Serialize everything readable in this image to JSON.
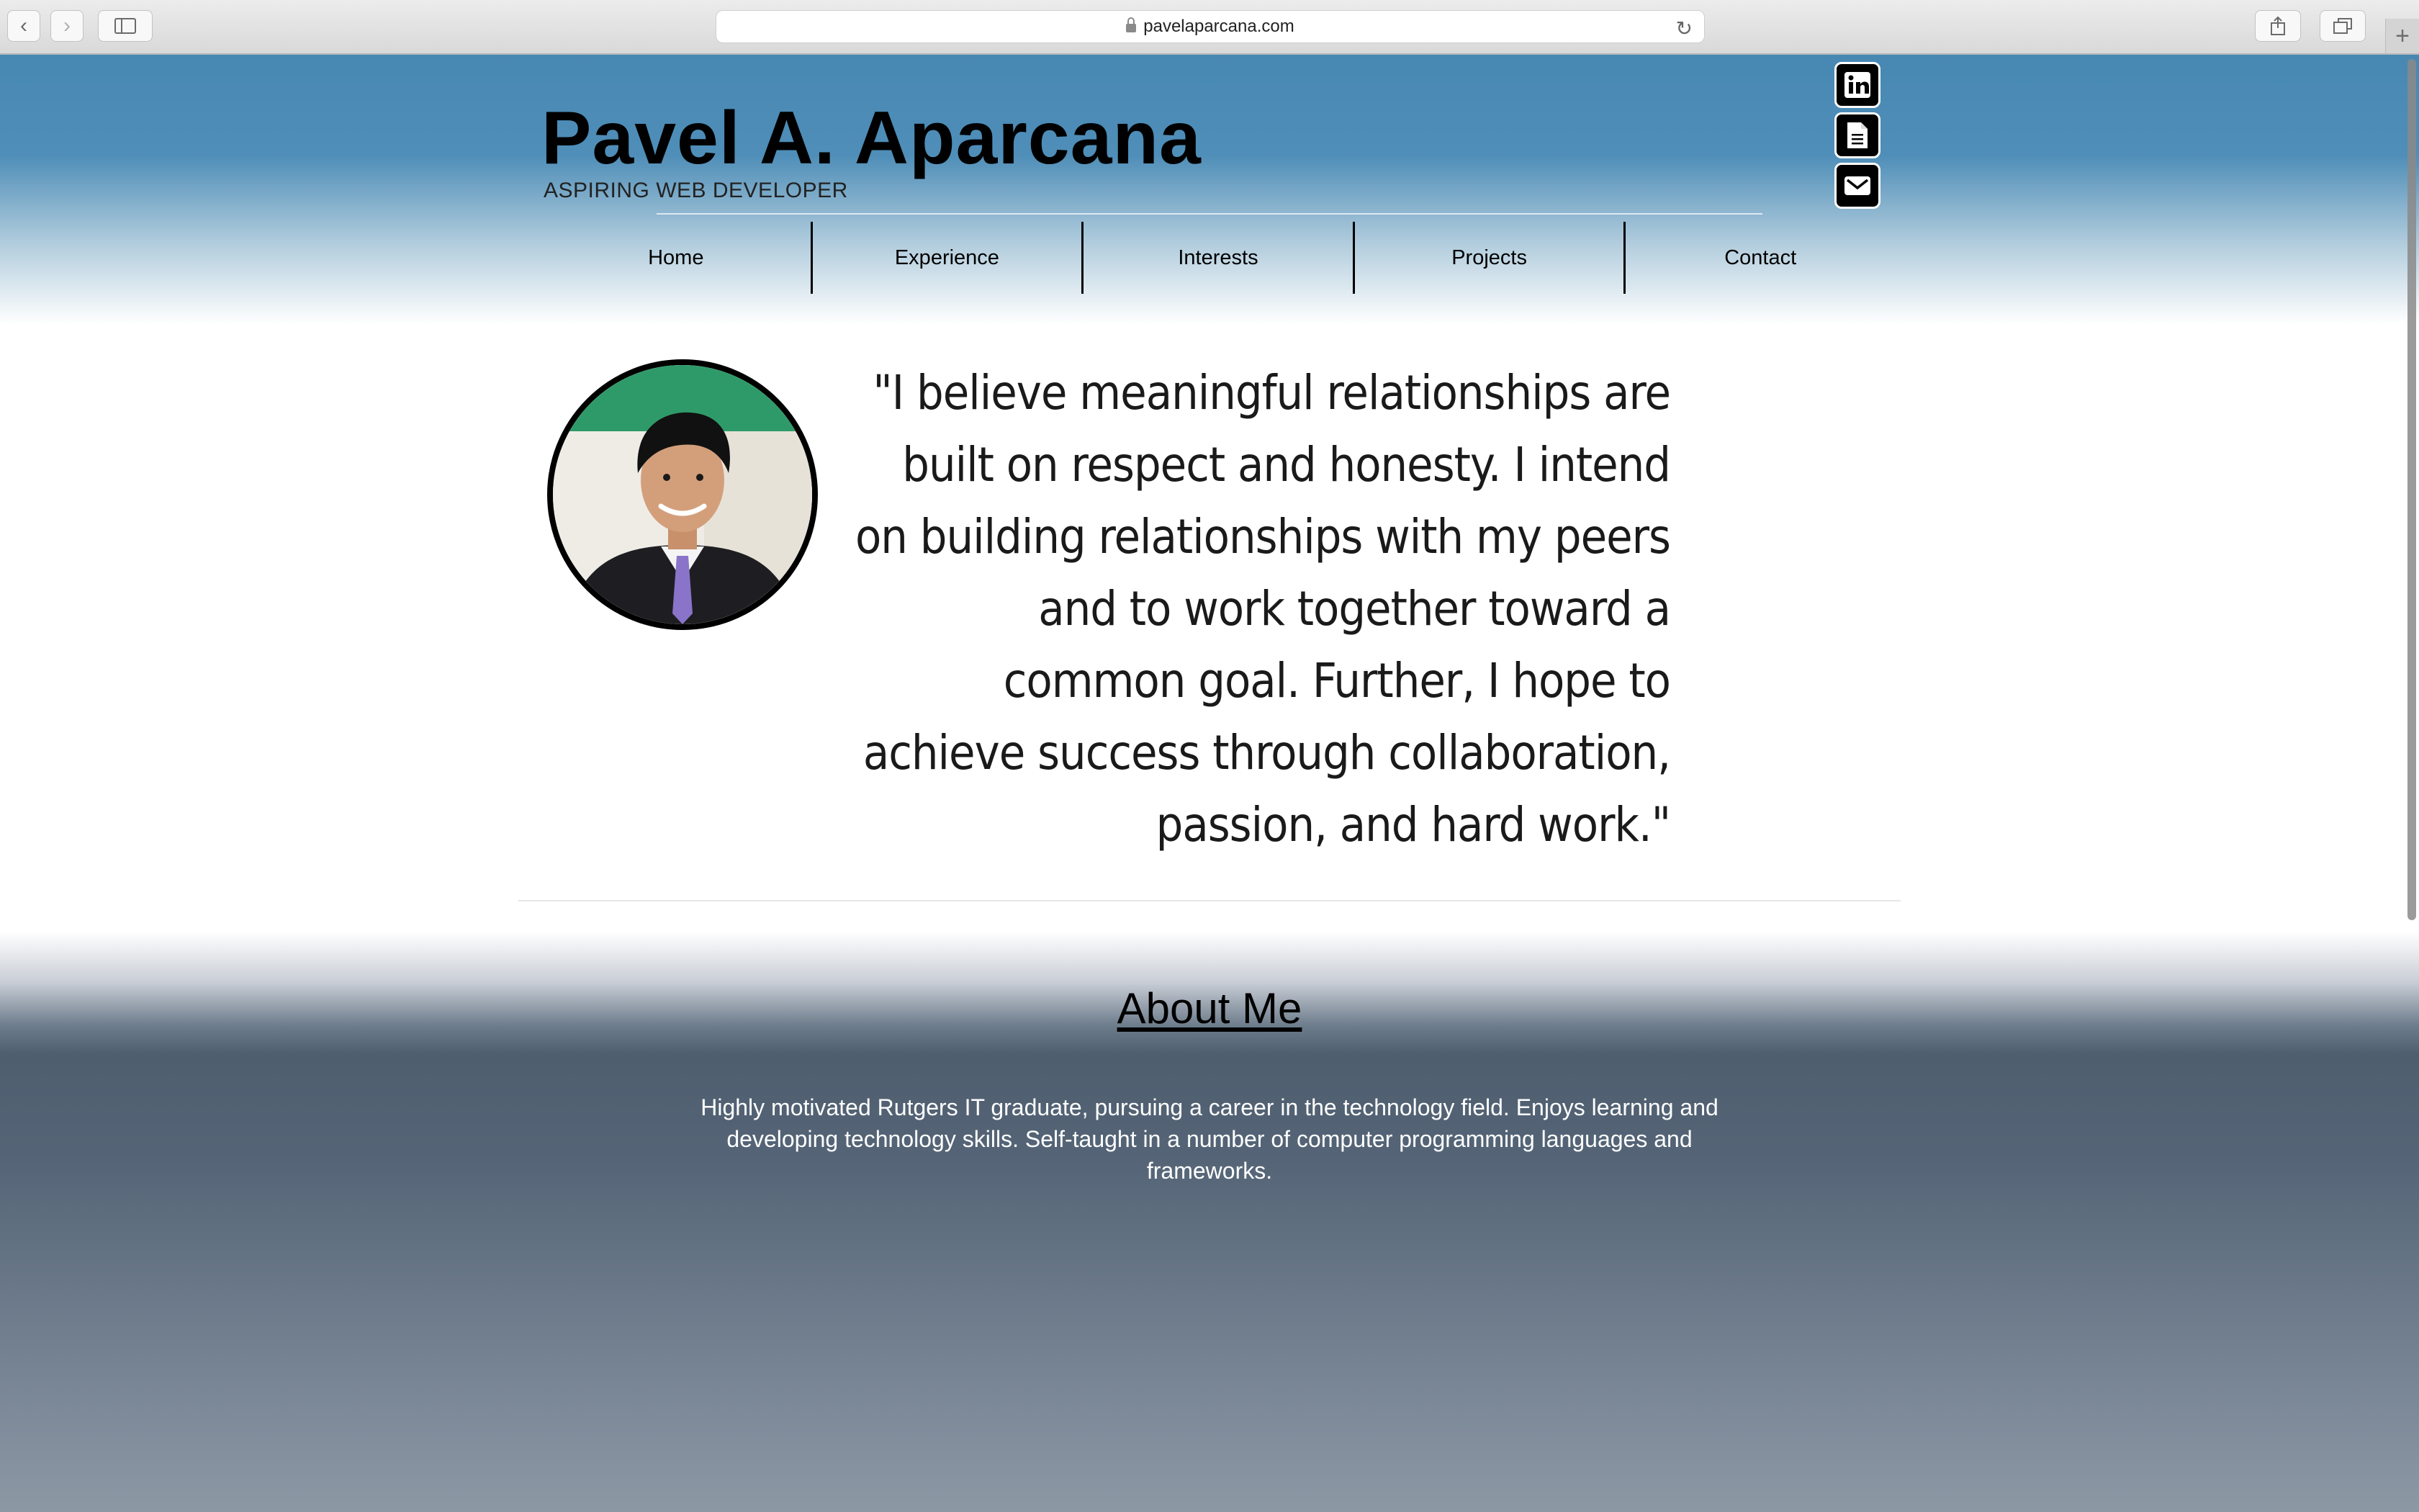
{
  "browser": {
    "url": "pavelaparcana.com",
    "back_label": "‹",
    "forward_label": "›",
    "new_tab_label": "+"
  },
  "site": {
    "title": "Pavel A. Aparcana",
    "subtitle": "ASPIRING WEB DEVELOPER"
  },
  "nav": {
    "items": [
      "Home",
      "Experience",
      "Interests",
      "Projects",
      "Contact"
    ]
  },
  "social": {
    "icons": [
      "linkedin-icon",
      "resume-document-icon",
      "email-icon"
    ]
  },
  "hero": {
    "quote": "\"I believe meaningful relationships are built on respect and honesty. I intend on building relationships with my peers and to work together toward a common goal. Further, I hope to achieve success through collaboration, passion, and hard work.\""
  },
  "about": {
    "title": "About Me",
    "text": "Highly motivated Rutgers IT graduate, pursuing a career in the technology field. Enjoys learning and developing technology skills. Self-taught in a number of computer programming languages and frameworks."
  },
  "colors": {
    "header_blue": "#4788b3",
    "about_slate": "#4e5e6f",
    "text_dark": "#000000"
  }
}
